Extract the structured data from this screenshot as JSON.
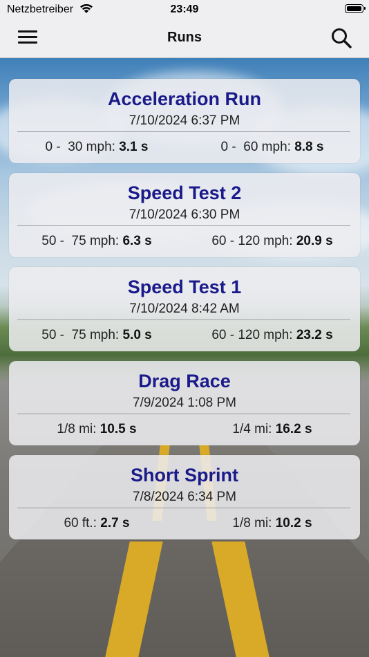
{
  "status_bar": {
    "carrier": "Netzbetreiber",
    "time": "23:49"
  },
  "nav": {
    "title": "Runs",
    "menu_icon": "hamburger-menu-icon",
    "search_icon": "search-icon"
  },
  "colors": {
    "title_blue": "#1a1a8a",
    "card_bg": "#ececf0",
    "bar_bg": "#efeff1",
    "road_stripe": "#d9a928"
  },
  "runs": [
    {
      "title": "Acceleration Run",
      "date": "7/10/2024 6:37 PM",
      "metrics": [
        {
          "label": "0 -  30 mph:",
          "value": "3.1 s"
        },
        {
          "label": "0 -  60 mph:",
          "value": "8.8 s"
        }
      ]
    },
    {
      "title": "Speed Test 2",
      "date": "7/10/2024 6:30 PM",
      "metrics": [
        {
          "label": "50 -  75 mph:",
          "value": "6.3 s"
        },
        {
          "label": "60 - 120 mph:",
          "value": "20.9 s"
        }
      ]
    },
    {
      "title": "Speed Test 1",
      "date": "7/10/2024 8:42 AM",
      "metrics": [
        {
          "label": "50 -  75 mph:",
          "value": "5.0 s"
        },
        {
          "label": "60 - 120 mph:",
          "value": "23.2 s"
        }
      ]
    },
    {
      "title": "Drag Race",
      "date": "7/9/2024 1:08 PM",
      "metrics": [
        {
          "label": "1/8 mi:",
          "value": "10.5 s"
        },
        {
          "label": "1/4 mi:",
          "value": "16.2 s"
        }
      ]
    },
    {
      "title": "Short Sprint",
      "date": "7/8/2024 6:34 PM",
      "metrics": [
        {
          "label": "60 ft.:",
          "value": "2.7 s"
        },
        {
          "label": "1/8 mi:",
          "value": "10.2 s"
        }
      ]
    }
  ]
}
